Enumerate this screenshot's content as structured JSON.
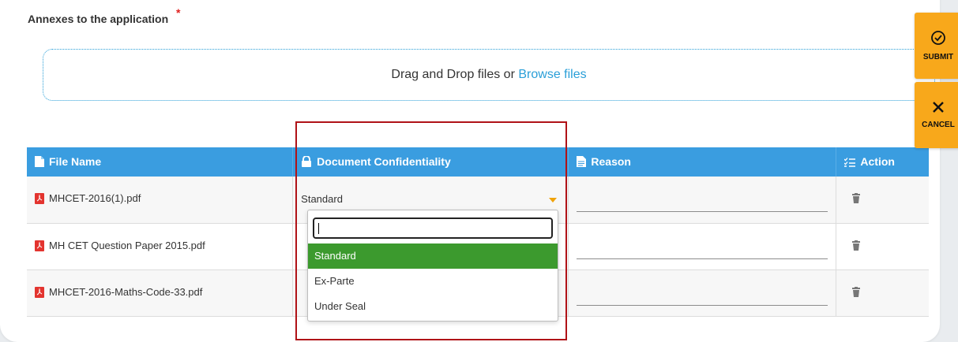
{
  "section": {
    "title": "Annexes to the application",
    "required_mark": "*"
  },
  "dropzone": {
    "text": "Drag and Drop files or ",
    "link": "Browse files"
  },
  "table": {
    "headers": {
      "file_name": "File Name",
      "confidentiality": "Document Confidentiality",
      "reason": "Reason",
      "action": "Action"
    },
    "rows": [
      {
        "file": "MHCET-2016(1).pdf",
        "confidentiality": "Standard"
      },
      {
        "file": "MH CET Question Paper 2015.pdf",
        "confidentiality": ""
      },
      {
        "file": "MHCET-2016-Maths-Code-33.pdf",
        "confidentiality": ""
      }
    ]
  },
  "dropdown": {
    "search_value": "",
    "options": [
      "Standard",
      "Ex-Parte",
      "Under Seal"
    ],
    "selected": "Standard"
  },
  "side_actions": {
    "submit": "SUBMIT",
    "cancel": "CANCEL"
  },
  "colors": {
    "header_bg": "#3a9de0",
    "accent_orange": "#f8a81b",
    "selected_green": "#3c9a2e",
    "highlight_red": "#b01217"
  }
}
